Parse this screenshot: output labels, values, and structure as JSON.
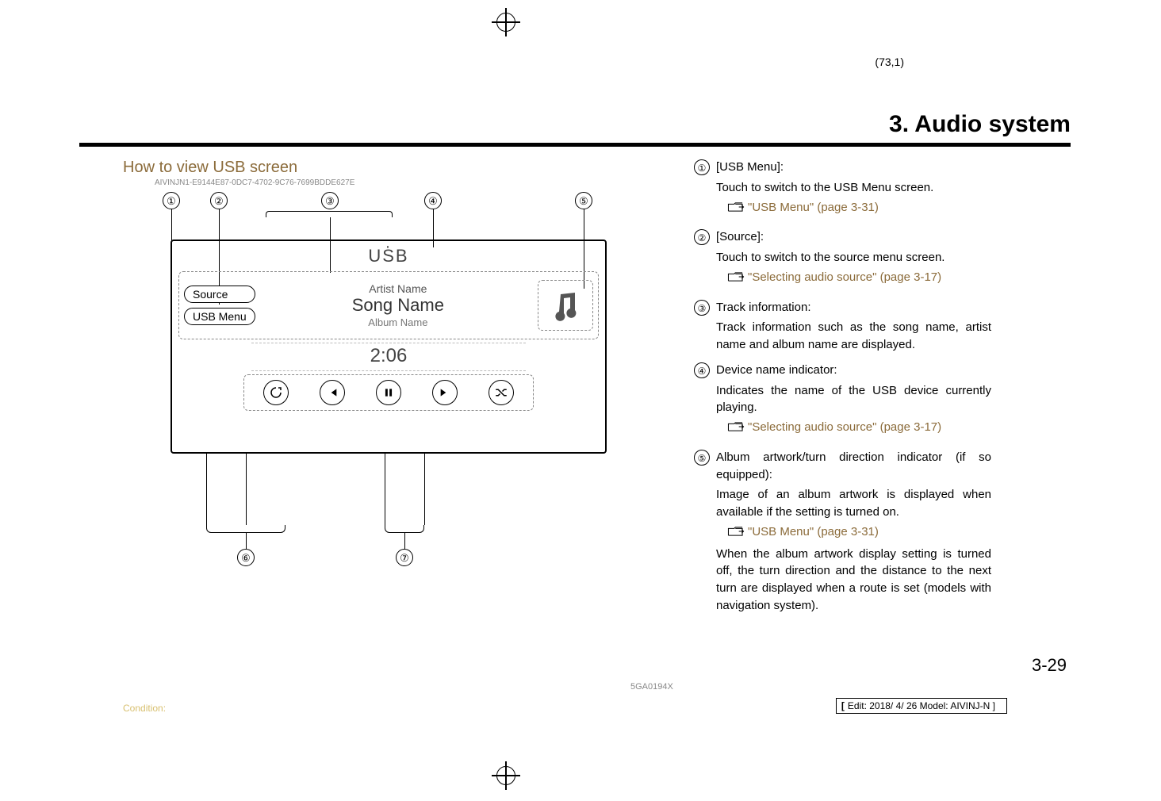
{
  "meta": {
    "sheet_ref": "(73,1)",
    "chapter_title": "3. Audio system",
    "page_number": "3-29",
    "condition_label": "Condition:",
    "edit_info": "Edit: 2018/ 4/ 26    Model:  AIVINJ-N",
    "fig_code": "5GA0194X"
  },
  "left": {
    "heading": "How to view USB screen",
    "ref_code": "AIVINJN1-E9144E87-0DC7-4702-9C76-7699BDDE627E",
    "callouts_top": [
      "①",
      "②",
      "③",
      "④",
      "⑤"
    ],
    "callouts_bottom": [
      "⑥",
      "⑦"
    ],
    "screen": {
      "title": "USB",
      "source_btn": "Source",
      "menu_btn": "USB Menu",
      "artist": "Artist Name",
      "song": "Song Name",
      "album": "Album Name",
      "time": "2:06",
      "controls": {
        "repeat": "↻",
        "prev": "⏮",
        "pause": "⏸",
        "next": "⏭",
        "shuffle": "✕"
      }
    }
  },
  "right": {
    "items": [
      {
        "num": "①",
        "label": "[USB Menu]:",
        "text": "Touch to switch to the USB Menu screen.",
        "refs": [
          {
            "text": "\"USB Menu\" (page 3-31)"
          }
        ]
      },
      {
        "num": "②",
        "label": "[Source]:",
        "text": "Touch to switch to the source menu screen.",
        "refs": [
          {
            "text": "\"Selecting audio source\" (page 3-17)"
          }
        ]
      },
      {
        "num": "③",
        "label": "Track information:",
        "text": "Track information such as the song name, artist name and album name are displayed.",
        "refs": []
      },
      {
        "num": "④",
        "label": "Device name indicator:",
        "text": "Indicates the name of the USB device currently playing.",
        "refs": [
          {
            "text": "\"Selecting audio source\" (page 3-17)"
          }
        ]
      },
      {
        "num": "⑤",
        "label": "Album artwork/turn direction indicator (if so equipped):",
        "text": "Image of an album artwork is displayed when available if the setting is turned on.",
        "refs": [
          {
            "text": "\"USB Menu\" (page 3-31)"
          }
        ],
        "text2": "When the album artwork display setting is turned off, the turn direction and the distance to the next turn are displayed when a route is set (models with navigation system)."
      }
    ]
  }
}
